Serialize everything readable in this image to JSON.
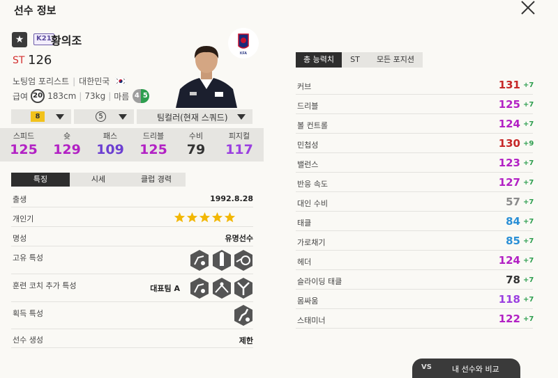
{
  "header": {
    "title": "선수 정보"
  },
  "player": {
    "grade_badge": "K21",
    "name": "황의조",
    "position": "ST",
    "overall": "126",
    "trait": "노팅엄 포리스트",
    "nation": "대한민국",
    "salary_label": "급여",
    "salary": "20",
    "height": "183cm",
    "weight": "73kg",
    "body_type": "마름",
    "foot_left": "4",
    "foot_right": "5"
  },
  "selectors": {
    "enhance_level": "8",
    "team_color_level": "5",
    "team": "팀컬러(현재 스쿼드)"
  },
  "stats": [
    {
      "label": "스피드",
      "value": "125",
      "color": "#b221c4"
    },
    {
      "label": "슛",
      "value": "129",
      "color": "#b221c4"
    },
    {
      "label": "패스",
      "value": "109",
      "color": "#6c3fd1"
    },
    {
      "label": "드리블",
      "value": "125",
      "color": "#b221c4"
    },
    {
      "label": "수비",
      "value": "79",
      "color": "#333333"
    },
    {
      "label": "피지컬",
      "value": "117",
      "color": "#9a3fe0"
    }
  ],
  "left_tabs": [
    "특징",
    "시세",
    "클럽 경력"
  ],
  "features": {
    "birth_label": "출생",
    "birth": "1992.8.28",
    "popularity_label": "개인기",
    "popularity_stars": 5,
    "fame_label": "명성",
    "fame": "유명선수",
    "unique_traits_label": "고유 특성",
    "coach_traits_label": "훈련 코치 추가 특성",
    "coach_traits_value": "대표팀 A",
    "acquired_traits_label": "획득 특성",
    "generation_label": "선수 생성",
    "generation": "제한"
  },
  "right_tabs": [
    "총 능력치",
    "ST",
    "모든 포지션"
  ],
  "attributes": [
    {
      "label": "커브",
      "value": "131",
      "plus": "+7",
      "color": "#c62828"
    },
    {
      "label": "드리블",
      "value": "125",
      "plus": "+7",
      "color": "#b221c4"
    },
    {
      "label": "볼 컨트롤",
      "value": "124",
      "plus": "+7",
      "color": "#b221c4"
    },
    {
      "label": "민첩성",
      "value": "130",
      "plus": "+9",
      "color": "#c62828"
    },
    {
      "label": "밸런스",
      "value": "123",
      "plus": "+7",
      "color": "#b221c4"
    },
    {
      "label": "반응 속도",
      "value": "127",
      "plus": "+7",
      "color": "#b221c4"
    },
    {
      "label": "대인 수비",
      "value": "57",
      "plus": "+7",
      "color": "#8a8a8a"
    },
    {
      "label": "태클",
      "value": "84",
      "plus": "+7",
      "color": "#2a8fd6"
    },
    {
      "label": "가로채기",
      "value": "85",
      "plus": "+7",
      "color": "#2a8fd6"
    },
    {
      "label": "헤더",
      "value": "124",
      "plus": "+7",
      "color": "#b221c4"
    },
    {
      "label": "슬라이딩 태클",
      "value": "78",
      "plus": "+7",
      "color": "#333333"
    },
    {
      "label": "몸싸움",
      "value": "118",
      "plus": "+7",
      "color": "#9a3fe0"
    },
    {
      "label": "스태미너",
      "value": "122",
      "plus": "+7",
      "color": "#b221c4"
    }
  ],
  "compare": {
    "vs": "VS",
    "label": "내 선수와 비교"
  }
}
